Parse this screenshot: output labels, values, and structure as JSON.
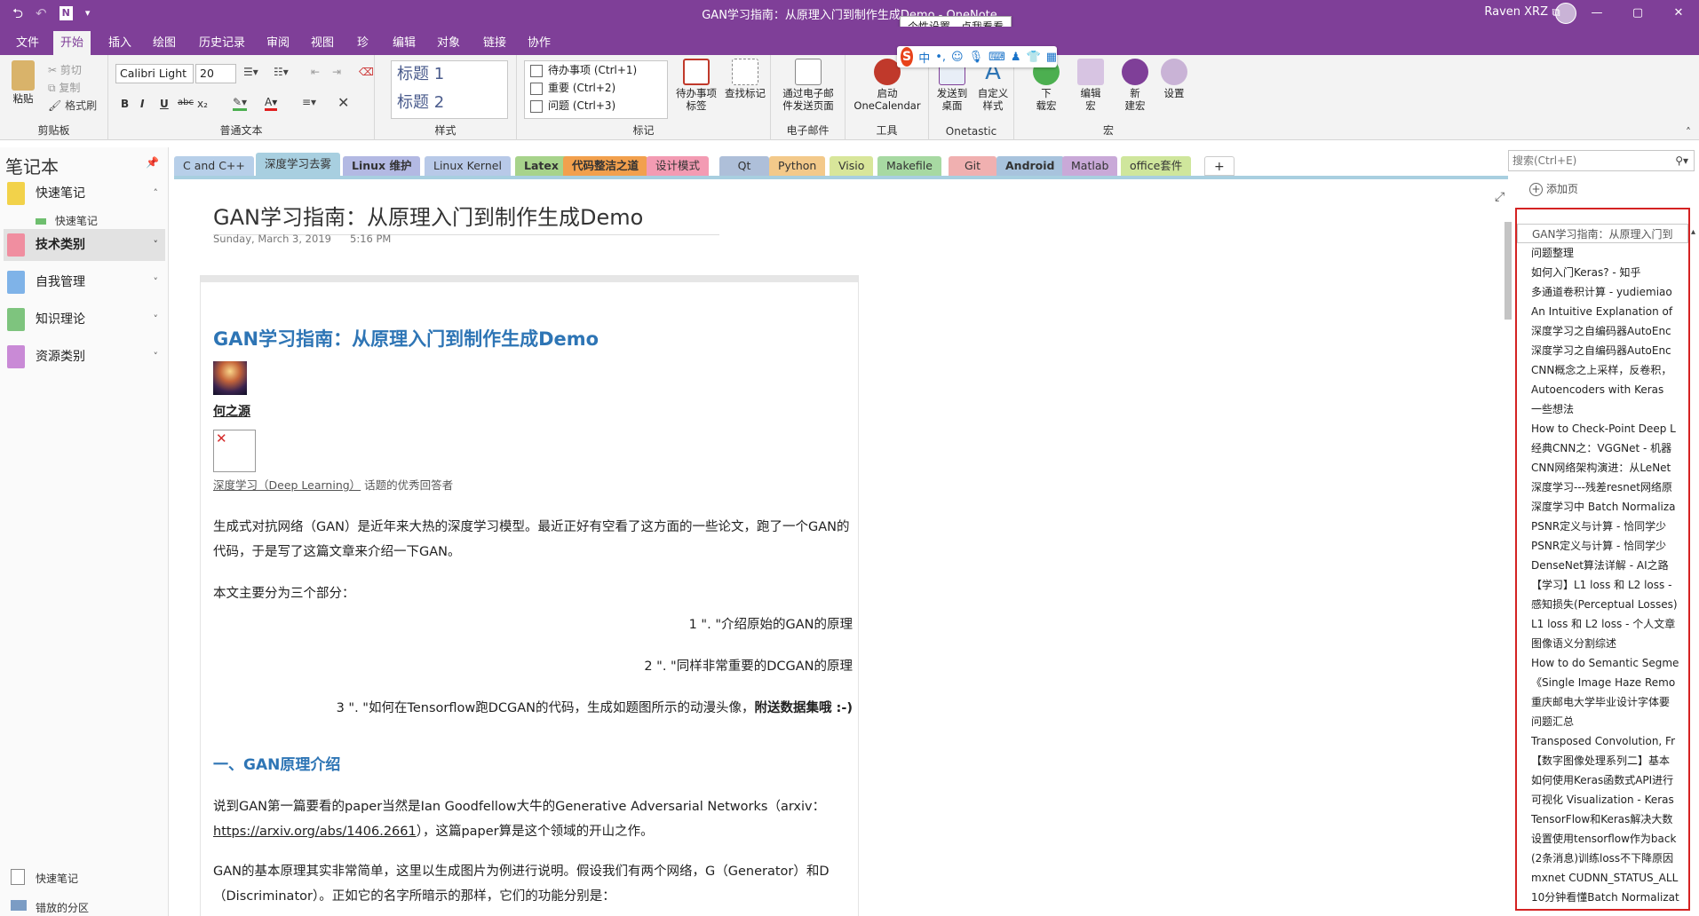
{
  "app": {
    "title": "GAN学习指南：从原理入门到制作生成Demo - OneNote",
    "user": "Raven XRZ",
    "win_buttons": [
      "⧉",
      "—",
      "▢",
      "✕"
    ]
  },
  "ribbon_tabs": [
    "文件",
    "开始",
    "插入",
    "绘图",
    "历史记录",
    "审阅",
    "视图",
    "珍",
    "编辑",
    "对象",
    "链接",
    "协作"
  ],
  "ime": {
    "tooltip": "个性设置，点我看看",
    "logo": "S",
    "mode": "中"
  },
  "ribbon": {
    "clipboard": {
      "paste": "粘贴",
      "cut": "剪切",
      "copy": "复制",
      "format_painter": "格式刷",
      "label": "剪贴板"
    },
    "basic_text": {
      "font": "Calibri Light",
      "size": "20",
      "bold": "B",
      "italic": "I",
      "underline": "U",
      "strike": "abc",
      "subscript": "x₂",
      "label": "普通文本"
    },
    "styles": {
      "h1": "标题 1",
      "h2": "标题 2",
      "label": "样式"
    },
    "tags": {
      "todo": "待办事项 (Ctrl+1)",
      "important": "重要 (Ctrl+2)",
      "question": "问题 (Ctrl+3)",
      "todo_tag": "待办事项\n标签",
      "find_tags": "查找标记",
      "label": "标记"
    },
    "email": {
      "send": "通过电子邮\n件发送页面",
      "label": "电子邮件"
    },
    "tools": {
      "calendar": "启动\nOneCalendar",
      "label": "工具"
    },
    "onetastic": {
      "send_desktop": "发送到\n桌面",
      "custom_style": "自定义\n样式",
      "label": "Onetastic"
    },
    "macros": {
      "download": "下\n载宏",
      "edit": "编辑\n宏",
      "new": "新\n建宏",
      "settings": "设置",
      "label": "宏"
    }
  },
  "notebooks": {
    "title": "笔记本",
    "items": [
      {
        "label": "快速笔记",
        "color": "#f2d24a"
      },
      {
        "label": "技术类别",
        "color": "#f08ea0"
      },
      {
        "label": "自我管理",
        "color": "#7fb3e8"
      },
      {
        "label": "知识理论",
        "color": "#7ec47e"
      },
      {
        "label": "资源类别",
        "color": "#c98ad6"
      }
    ],
    "sub_quick": "快速笔记",
    "footer_quick": "快速笔记",
    "footer_misplaced": "错放的分区"
  },
  "sections": [
    {
      "label": "C and C++",
      "color": "#b7cfe9"
    },
    {
      "label": "深度学习去雾",
      "color": "#a8cfe0",
      "active": true
    },
    {
      "label": "Linux 维护",
      "color": "#b3b9e3"
    },
    {
      "label": "Linux Kernel",
      "color": "#b8c9e8"
    },
    {
      "label": "Latex",
      "color": "#a7d38b"
    },
    {
      "label": "代码整洁之道",
      "color": "#f2a04d"
    },
    {
      "label": "设计模式",
      "color": "#f39bb3"
    },
    {
      "label": "Qt",
      "color": "#aebfd9"
    },
    {
      "label": "Python",
      "color": "#f3c98a"
    },
    {
      "label": "Visio",
      "color": "#d8e69a"
    },
    {
      "label": "Makefile",
      "color": "#a7d9a2"
    },
    {
      "label": "Git",
      "color": "#f0b0b0"
    },
    {
      "label": "Android",
      "color": "#a8c3dd"
    },
    {
      "label": "Matlab",
      "color": "#c9a9d8"
    },
    {
      "label": "office套件",
      "color": "#cfe69c"
    }
  ],
  "search": {
    "placeholder": "搜索(Ctrl+E)"
  },
  "page": {
    "title": "GAN学习指南：从原理入门到制作生成Demo",
    "date": "Sunday, March 3, 2019",
    "time": "5:16 PM",
    "article_title": "GAN学习指南：从原理入门到制作生成Demo",
    "author": "何之源",
    "author_desc_link": "深度学习（Deep Learning）",
    "author_desc": "话题的优秀回答者",
    "p1": "生成式对抗网络（GAN）是近年来大热的深度学习模型。最近正好有空看了这方面的一些论文，跑了一个GAN的代码，于是写了这篇文章来介绍一下GAN。",
    "p2": "本文主要分为三个部分：",
    "list1": "1 \". \"介绍原始的GAN的原理",
    "list2": "2 \". \"同样非常重要的DCGAN的原理",
    "list3": "3 \". \"如何在Tensorflow跑DCGAN的代码，生成如题图所示的动漫头像，",
    "list3_bold": "附送数据集哦 :-)",
    "section1": "一、GAN原理介绍",
    "p3": "说到GAN第一篇要看的paper当然是Ian Goodfellow大牛的Generative Adversarial Networks（arxiv：",
    "p3_link": "https://arxiv.org/abs/1406.2661",
    "p3_end": "），这篇paper算是这个领域的开山之作。",
    "p4": "GAN的基本原理其实非常简单，这里以生成图片为例进行说明。假设我们有两个网络，G（Generator）和D（Discriminator）。正如它的名字所暗示的那样，它们的功能分别是："
  },
  "pagelist": {
    "add_page": "添加页",
    "pages": [
      "GAN学习指南：从原理入门到",
      "问题整理",
      "如何入门Keras? - 知乎",
      "多通道卷积计算 - yudiemiao",
      "An Intuitive Explanation of",
      "深度学习之自编码器AutoEnc",
      "深度学习之自编码器AutoEnc",
      "CNN概念之上采样，反卷积，",
      "Autoencoders with Keras",
      "一些想法",
      "How to Check-Point Deep L",
      "经典CNN之：VGGNet - 机器",
      "CNN网络架构演进：从LeNet",
      "深度学习---残差resnet网络原",
      "深度学习中 Batch Normaliza",
      "PSNR定义与计算 - 恰同学少",
      "PSNR定义与计算 - 恰同学少",
      "DenseNet算法详解 - AI之路",
      "【学习】L1 loss 和 L2 loss -",
      "感知损失(Perceptual Losses)",
      "L1 loss 和 L2 loss - 个人文章",
      "图像语义分割综述",
      "How to do Semantic Segme",
      "《Single Image Haze Remo",
      "重庆邮电大学毕业设计字体要",
      "问题汇总",
      "Transposed Convolution, Fr",
      "【数字图像处理系列二】基本",
      "如何使用Keras函数式API进行",
      "可视化 Visualization - Keras",
      "TensorFlow和Keras解决大数",
      "设置使用tensorflow作为back",
      "(2条消息)训练loss不下降原因",
      "mxnet CUDNN_STATUS_ALL",
      "10分钟看懂Batch Normalizat"
    ]
  }
}
